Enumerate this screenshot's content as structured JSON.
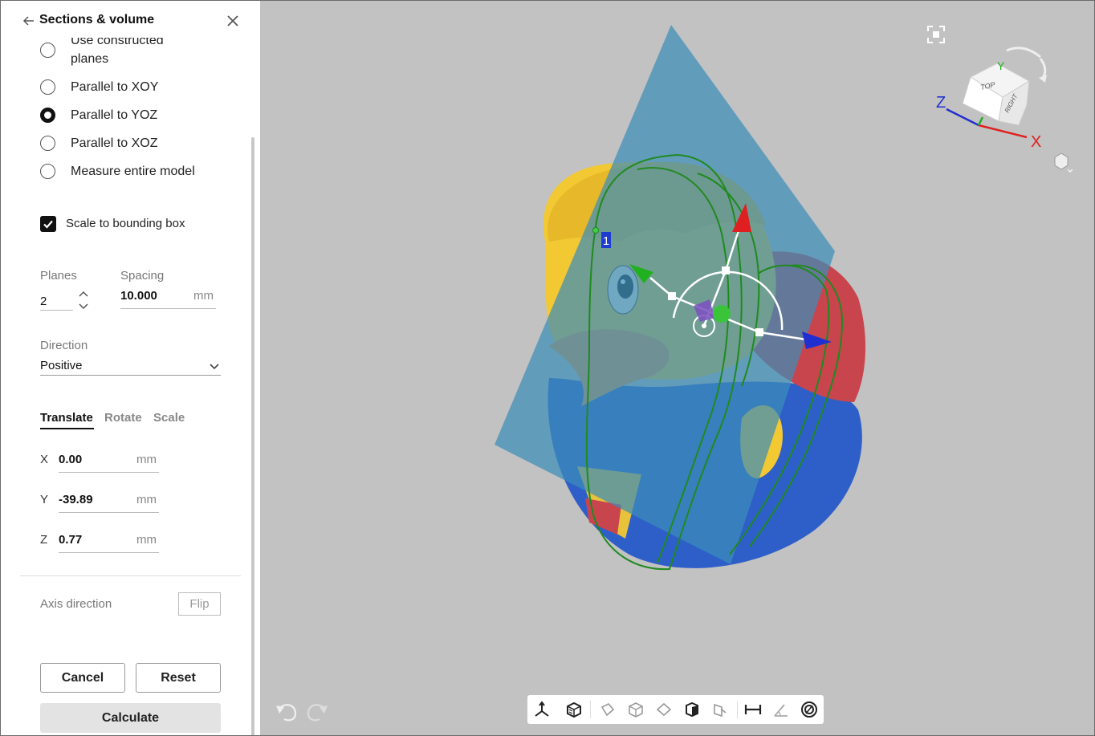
{
  "panel": {
    "title": "Sections & volume",
    "radio_options": [
      {
        "label": "Use constructed",
        "label2": "planes",
        "checked": false
      },
      {
        "label": "Parallel to XOY",
        "checked": false
      },
      {
        "label": "Parallel to YOZ",
        "checked": true
      },
      {
        "label": "Parallel to XOZ",
        "checked": false
      },
      {
        "label": "Measure entire model",
        "checked": false
      }
    ],
    "scale_checkbox": {
      "label": "Scale to bounding box",
      "checked": true
    },
    "planes": {
      "label": "Planes",
      "value": "2"
    },
    "spacing": {
      "label": "Spacing",
      "value": "10.000",
      "unit": "mm"
    },
    "direction": {
      "label": "Direction",
      "value": "Positive"
    },
    "tabs": [
      "Translate",
      "Rotate",
      "Scale"
    ],
    "translate": {
      "x": {
        "label": "X",
        "value": "0.00",
        "unit": "mm"
      },
      "y": {
        "label": "Y",
        "value": "-39.89",
        "unit": "mm"
      },
      "z": {
        "label": "Z",
        "value": "0.77",
        "unit": "mm"
      }
    },
    "axis_direction": {
      "label": "Axis direction",
      "button": "Flip"
    },
    "buttons": {
      "cancel": "Cancel",
      "reset": "Reset",
      "calculate": "Calculate"
    }
  },
  "viewport": {
    "section_marker": "1",
    "view_cube": {
      "top": "TOP",
      "right": "RIGHT"
    },
    "axes": {
      "x": "X",
      "y": "Y",
      "z": "Z"
    },
    "colors": {
      "background": "#c2c2c2",
      "plane": "#3d8db8",
      "x_axis": "#e02020",
      "y_axis": "#20b020",
      "z_axis": "#2030d0",
      "section_outline": "#1f8a1f"
    }
  },
  "icons": [
    "back-arrow-icon",
    "close-icon",
    "checkmark-icon",
    "stepper-icon",
    "chevron-down-icon",
    "fit-view-icon",
    "undo-icon",
    "redo-icon",
    "view-mode-icon"
  ]
}
